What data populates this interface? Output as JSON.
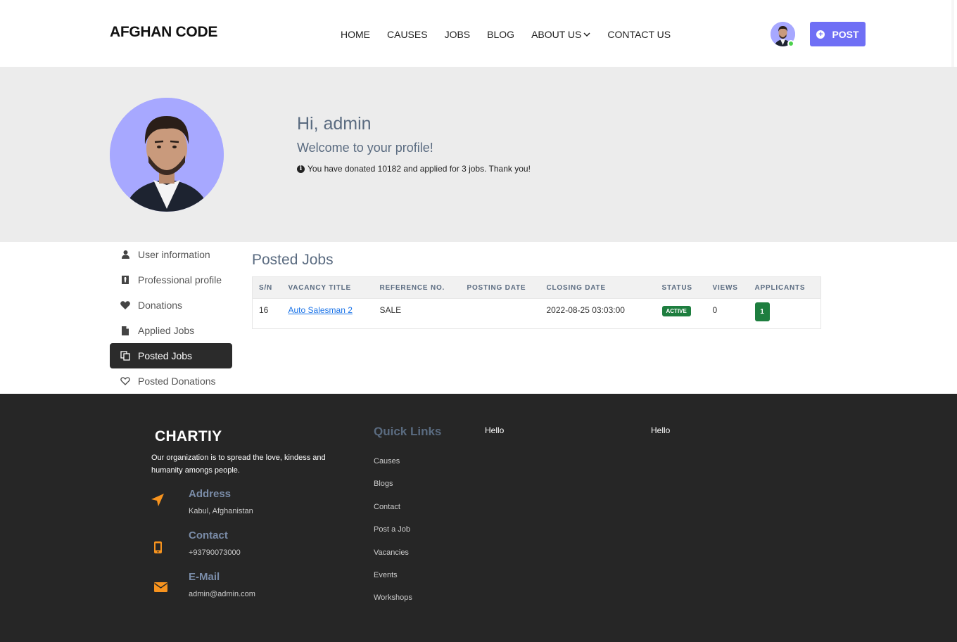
{
  "header": {
    "logo": "AFGHAN CODE",
    "nav": [
      "HOME",
      "CAUSES",
      "JOBS",
      "BLOG",
      "ABOUT US",
      "CONTACT US"
    ],
    "post_label": "POST"
  },
  "profile": {
    "greeting": "Hi, admin",
    "welcome": "Welcome to your profile!",
    "summary": "You have donated 10182 and applied for 3 jobs. Thank you!"
  },
  "sidebar": {
    "items": [
      {
        "label": "User information",
        "icon": "user-icon"
      },
      {
        "label": "Professional profile",
        "icon": "tie-icon"
      },
      {
        "label": "Donations",
        "icon": "heart-icon"
      },
      {
        "label": "Applied Jobs",
        "icon": "file-icon"
      },
      {
        "label": "Posted Jobs",
        "icon": "copy-icon",
        "active": true
      },
      {
        "label": "Posted Donations",
        "icon": "heart-outline-icon"
      }
    ]
  },
  "posted_jobs": {
    "title": "Posted Jobs",
    "columns": [
      "S/N",
      "VACANCY TITLE",
      "REFERENCE NO.",
      "POSTING DATE",
      "CLOSING DATE",
      "STATUS",
      "VIEWS",
      "APPLICANTS"
    ],
    "rows": [
      {
        "sn": "16",
        "title": "Auto Salesman 2",
        "reference": "SALE",
        "posting_date": "",
        "closing_date": "2022-08-25 03:03:00",
        "status": "ACTIVE",
        "views": "0",
        "applicants": "1"
      }
    ]
  },
  "footer": {
    "logo": "CHARTIY",
    "description": "Our organization is to spread the love, kindess and humanity amongs people.",
    "address_title": "Address",
    "address_value": "Kabul, Afghanistan",
    "contact_title": "Contact",
    "contact_value": "+93790073000",
    "email_title": "E-Mail",
    "email_value": "admin@admin.com",
    "quick_links_title": "Quick Links",
    "quick_links": [
      "Causes",
      "Blogs",
      "Contact",
      "Post a Job",
      "Vacancies",
      "Events",
      "Workshops"
    ],
    "hello_1": "Hello",
    "hello_2": "Hello"
  },
  "colors": {
    "accent": "#6f6ff5",
    "avatar_bg": "#a7a8ff",
    "active_badge": "#1e7e3f",
    "footer_bg": "#262626",
    "footer_icon": "#f7931e"
  }
}
